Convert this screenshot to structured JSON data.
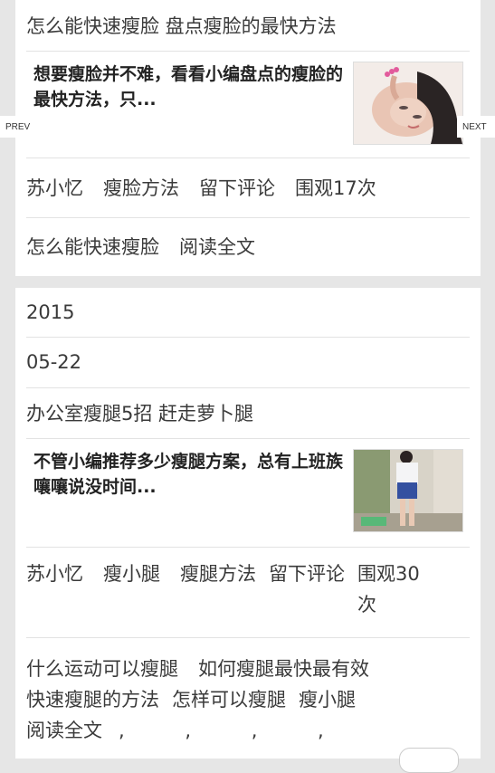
{
  "nav": {
    "prev_label": "PREV",
    "next_label": "NEXT"
  },
  "post1": {
    "title": "怎么能快速瘦脸 盘点瘦脸的最快方法",
    "excerpt": "想要瘦脸并不难，看看小编盘点的瘦脸的最快方法，只...",
    "meta": {
      "author": "苏小忆",
      "category": "瘦脸方法",
      "comment": "留下评论",
      "views": "围观17次"
    },
    "tag": "怎么能快速瘦脸",
    "read_more": "阅读全文"
  },
  "post2": {
    "year": "2015",
    "date": "05-22",
    "title": "办公室瘦腿5招 赶走萝卜腿",
    "excerpt": "不管小编推荐多少瘦腿方案，总有上班族嚷嚷说没时间...",
    "meta": {
      "author": "苏小忆",
      "cat1": "瘦小腿",
      "cat2": "瘦腿方法",
      "comment": "留下评论",
      "views": "围观30次"
    },
    "tags": [
      "什么运动可以瘦腿",
      "如何瘦腿最快最有效",
      "快速瘦腿的方法",
      "怎样可以瘦腿",
      "瘦小腿"
    ],
    "read_more": "阅读全文",
    "separators": ", , , ,"
  }
}
